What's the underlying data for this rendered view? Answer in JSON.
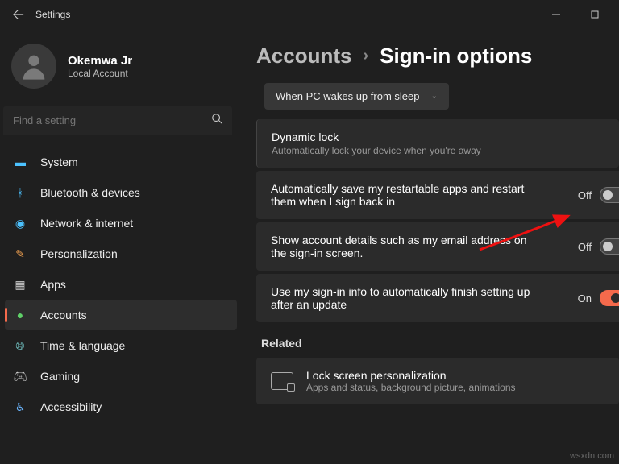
{
  "window": {
    "title": "Settings"
  },
  "profile": {
    "name": "Okemwa Jr",
    "subtitle": "Local Account"
  },
  "search": {
    "placeholder": "Find a setting"
  },
  "nav": {
    "system": "System",
    "bluetooth": "Bluetooth & devices",
    "network": "Network & internet",
    "personalization": "Personalization",
    "apps": "Apps",
    "accounts": "Accounts",
    "time": "Time & language",
    "gaming": "Gaming",
    "accessibility": "Accessibility"
  },
  "breadcrumb": {
    "root": "Accounts",
    "current": "Sign-in options"
  },
  "dropdown": {
    "label": "When PC wakes up from sleep"
  },
  "dynamicLock": {
    "title": "Dynamic lock",
    "desc": "Automatically lock your device when you're away"
  },
  "settings": [
    {
      "label": "Automatically save my restartable apps and restart them when I sign back in",
      "state": "Off",
      "on": false
    },
    {
      "label": "Show account details such as my email address on the sign-in screen.",
      "state": "Off",
      "on": false
    },
    {
      "label": "Use my sign-in info to automatically finish setting up after an update",
      "state": "On",
      "on": true
    }
  ],
  "related": {
    "heading": "Related",
    "item": {
      "title": "Lock screen personalization",
      "desc": "Apps and status, background picture, animations"
    }
  },
  "watermark": "wsxdn.com"
}
